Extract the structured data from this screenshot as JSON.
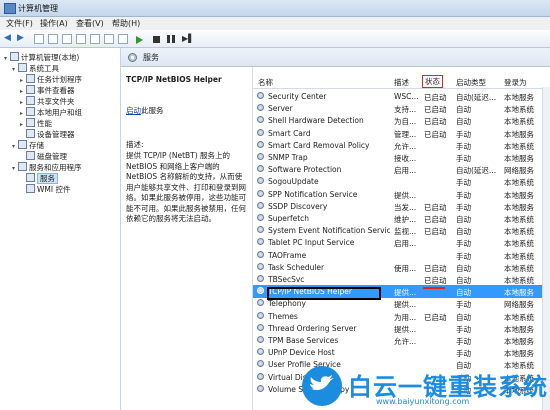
{
  "window": {
    "title": "计算机管理"
  },
  "menu": [
    "文件(F)",
    "操作(A)",
    "查看(V)",
    "帮助(H)"
  ],
  "tree": [
    {
      "label": "计算机管理(本地)",
      "level": 0,
      "expander": "▾"
    },
    {
      "label": "系统工具",
      "level": 1,
      "expander": "▾"
    },
    {
      "label": "任务计划程序",
      "level": 2,
      "expander": "▸"
    },
    {
      "label": "事件查看器",
      "level": 2,
      "expander": "▸"
    },
    {
      "label": "共享文件夹",
      "level": 2,
      "expander": "▸"
    },
    {
      "label": "本地用户和组",
      "level": 2,
      "expander": "▸"
    },
    {
      "label": "性能",
      "level": 2,
      "expander": "▸"
    },
    {
      "label": "设备管理器",
      "level": 2,
      "expander": ""
    },
    {
      "label": "存储",
      "level": 1,
      "expander": "▾"
    },
    {
      "label": "磁盘管理",
      "level": 2,
      "expander": ""
    },
    {
      "label": "服务和应用程序",
      "level": 1,
      "expander": "▾"
    },
    {
      "label": "服务",
      "level": 2,
      "expander": "",
      "selected": true
    },
    {
      "label": "WMI 控件",
      "level": 2,
      "expander": ""
    }
  ],
  "main": {
    "header": "服务"
  },
  "detail": {
    "title": "TCP/IP NetBIOS Helper",
    "link": "启动",
    "link_suffix": "此服务",
    "desc_label": "描述:",
    "desc_text": "提供 TCP/IP (NetBT) 服务上的 NetBIOS 和网络上客户端的 NetBIOS 名称解析的支持，从而使用户能够共享文件、打印和登录到网络。如果此服务被停用，这些功能可能不可用。如果此服务被禁用，任何依赖它的服务将无法启动。"
  },
  "columns": {
    "name": "名称",
    "desc": "描述",
    "status": "状态",
    "startup": "启动类型",
    "logon": "登录为"
  },
  "services": [
    {
      "name": "Security Center",
      "desc": "WSC...",
      "status": "已启动",
      "startup": "自动(延迟...",
      "logon": "本地服务"
    },
    {
      "name": "Server",
      "desc": "支持...",
      "status": "已启动",
      "startup": "自动",
      "logon": "本地系统"
    },
    {
      "name": "Shell Hardware Detection",
      "desc": "为自...",
      "status": "已启动",
      "startup": "自动",
      "logon": "本地系统"
    },
    {
      "name": "Smart Card",
      "desc": "管理...",
      "status": "已启动",
      "startup": "手动",
      "logon": "本地服务"
    },
    {
      "name": "Smart Card Removal Policy",
      "desc": "允许...",
      "status": "",
      "startup": "手动",
      "logon": "本地系统"
    },
    {
      "name": "SNMP Trap",
      "desc": "接收...",
      "status": "",
      "startup": "手动",
      "logon": "本地服务"
    },
    {
      "name": "Software Protection",
      "desc": "启用...",
      "status": "",
      "startup": "自动(延迟...",
      "logon": "网络服务"
    },
    {
      "name": "SogouUpdate",
      "desc": "",
      "status": "",
      "startup": "手动",
      "logon": "本地系统"
    },
    {
      "name": "SPP Notification Service",
      "desc": "提供...",
      "status": "",
      "startup": "手动",
      "logon": "本地服务"
    },
    {
      "name": "SSDP Discovery",
      "desc": "当发...",
      "status": "已启动",
      "startup": "手动",
      "logon": "本地服务"
    },
    {
      "name": "Superfetch",
      "desc": "维护...",
      "status": "已启动",
      "startup": "自动",
      "logon": "本地系统"
    },
    {
      "name": "System Event Notification Service",
      "desc": "监视...",
      "status": "已启动",
      "startup": "自动",
      "logon": "本地系统"
    },
    {
      "name": "Tablet PC Input Service",
      "desc": "启用...",
      "status": "",
      "startup": "手动",
      "logon": "本地系统"
    },
    {
      "name": "TAOFrame",
      "desc": "",
      "status": "",
      "startup": "手动",
      "logon": "本地系统"
    },
    {
      "name": "Task Scheduler",
      "desc": "使用...",
      "status": "已启动",
      "startup": "自动",
      "logon": "本地系统"
    },
    {
      "name": "TBSecSvc",
      "desc": "",
      "status": "已启动",
      "startup": "自动",
      "logon": "本地系统"
    },
    {
      "name": "TCP/IP NetBIOS Helper",
      "desc": "提供...",
      "status": "",
      "startup": "自动",
      "logon": "本地服务",
      "selected": true
    },
    {
      "name": "Telephony",
      "desc": "提供...",
      "status": "",
      "startup": "手动",
      "logon": "网络服务"
    },
    {
      "name": "Themes",
      "desc": "为用...",
      "status": "已启动",
      "startup": "自动",
      "logon": "本地系统"
    },
    {
      "name": "Thread Ordering Server",
      "desc": "提供...",
      "status": "",
      "startup": "手动",
      "logon": "本地服务"
    },
    {
      "name": "TPM Base Services",
      "desc": "允许...",
      "status": "",
      "startup": "手动",
      "logon": "本地服务"
    },
    {
      "name": "UPnP Device Host",
      "desc": "",
      "status": "",
      "startup": "手动",
      "logon": "本地服务"
    },
    {
      "name": "User Profile Service",
      "desc": "",
      "status": "",
      "startup": "自动",
      "logon": "本地系统"
    },
    {
      "name": "Virtual Disk",
      "desc": "",
      "status": "",
      "startup": "手动",
      "logon": "本地系统"
    },
    {
      "name": "Volume Shadow Copy",
      "desc": "",
      "status": "",
      "startup": "手动",
      "logon": "本地系统"
    }
  ],
  "watermark": {
    "brand": "白云一键重装系统",
    "url": "www.baiyunxitong.com"
  },
  "colors": {
    "selection": "#3399ff",
    "highlight_red": "#e3231c",
    "brand_blue": "#1b8de0"
  }
}
